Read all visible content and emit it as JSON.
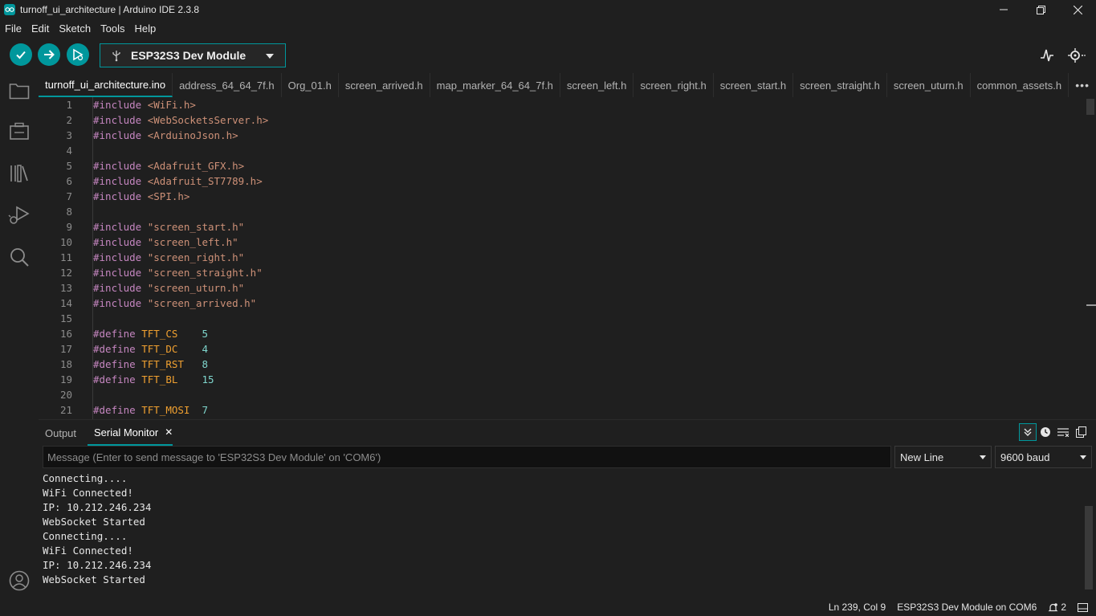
{
  "window": {
    "title": "turnoff_ui_architecture | Arduino IDE 2.3.8"
  },
  "menu": [
    "File",
    "Edit",
    "Sketch",
    "Tools",
    "Help"
  ],
  "toolbar": {
    "board": "ESP32S3 Dev Module",
    "icons": [
      "verify-icon",
      "upload-icon",
      "debug-icon",
      "usb-icon",
      "serial-plotter-icon",
      "serial-monitor-icon"
    ]
  },
  "tabs": [
    "turnoff_ui_architecture.ino",
    "address_64_64_7f.h",
    "Org_01.h",
    "screen_arrived.h",
    "map_marker_64_64_7f.h",
    "screen_left.h",
    "screen_right.h",
    "screen_start.h",
    "screen_straight.h",
    "screen_uturn.h",
    "common_assets.h"
  ],
  "tabs_more": "•••",
  "code_lines": [
    {
      "n": "1",
      "kw": "#include",
      "arg": "<WiFi.h>",
      "type": "inc"
    },
    {
      "n": "2",
      "kw": "#include",
      "arg": "<WebSocketsServer.h>",
      "type": "inc"
    },
    {
      "n": "3",
      "kw": "#include",
      "arg": "<ArduinoJson.h>",
      "type": "inc"
    },
    {
      "n": "4",
      "kw": "",
      "arg": "",
      "type": "blank"
    },
    {
      "n": "5",
      "kw": "#include",
      "arg": "<Adafruit_GFX.h>",
      "type": "inc"
    },
    {
      "n": "6",
      "kw": "#include",
      "arg": "<Adafruit_ST7789.h>",
      "type": "inc"
    },
    {
      "n": "7",
      "kw": "#include",
      "arg": "<SPI.h>",
      "type": "inc"
    },
    {
      "n": "8",
      "kw": "",
      "arg": "",
      "type": "blank"
    },
    {
      "n": "9",
      "kw": "#include",
      "arg": "\"screen_start.h\"",
      "type": "inc"
    },
    {
      "n": "10",
      "kw": "#include",
      "arg": "\"screen_left.h\"",
      "type": "inc"
    },
    {
      "n": "11",
      "kw": "#include",
      "arg": "\"screen_right.h\"",
      "type": "inc"
    },
    {
      "n": "12",
      "kw": "#include",
      "arg": "\"screen_straight.h\"",
      "type": "inc"
    },
    {
      "n": "13",
      "kw": "#include",
      "arg": "\"screen_uturn.h\"",
      "type": "inc"
    },
    {
      "n": "14",
      "kw": "#include",
      "arg": "\"screen_arrived.h\"",
      "type": "inc"
    },
    {
      "n": "15",
      "kw": "",
      "arg": "",
      "type": "blank"
    },
    {
      "n": "16",
      "kw": "#define",
      "arg": "TFT_CS",
      "pad": "    ",
      "val": "5",
      "type": "def"
    },
    {
      "n": "17",
      "kw": "#define",
      "arg": "TFT_DC",
      "pad": "    ",
      "val": "4",
      "type": "def"
    },
    {
      "n": "18",
      "kw": "#define",
      "arg": "TFT_RST",
      "pad": "   ",
      "val": "8",
      "type": "def"
    },
    {
      "n": "19",
      "kw": "#define",
      "arg": "TFT_BL",
      "pad": "    ",
      "val": "15",
      "type": "def"
    },
    {
      "n": "20",
      "kw": "",
      "arg": "",
      "type": "blank"
    },
    {
      "n": "21",
      "kw": "#define",
      "arg": "TFT_MOSI",
      "pad": "  ",
      "val": "7",
      "type": "def"
    }
  ],
  "panel": {
    "tab_output": "Output",
    "tab_serial": "Serial Monitor",
    "close": "✕",
    "message_placeholder": "Message (Enter to send message to 'ESP32S3 Dev Module' on 'COM6')",
    "line_ending": "New Line",
    "baud": "9600 baud",
    "serial_lines": [
      "Connecting....",
      "WiFi Connected!",
      "IP: 10.212.246.234",
      "WebSocket Started",
      "Connecting....",
      "WiFi Connected!",
      "IP: 10.212.246.234",
      "WebSocket Started"
    ]
  },
  "status": {
    "position": "Ln 239, Col 9",
    "board_port": "ESP32S3 Dev Module on COM6",
    "notifications": "2"
  },
  "colors": {
    "accent": "#00979c",
    "background": "#1f1f1f"
  }
}
